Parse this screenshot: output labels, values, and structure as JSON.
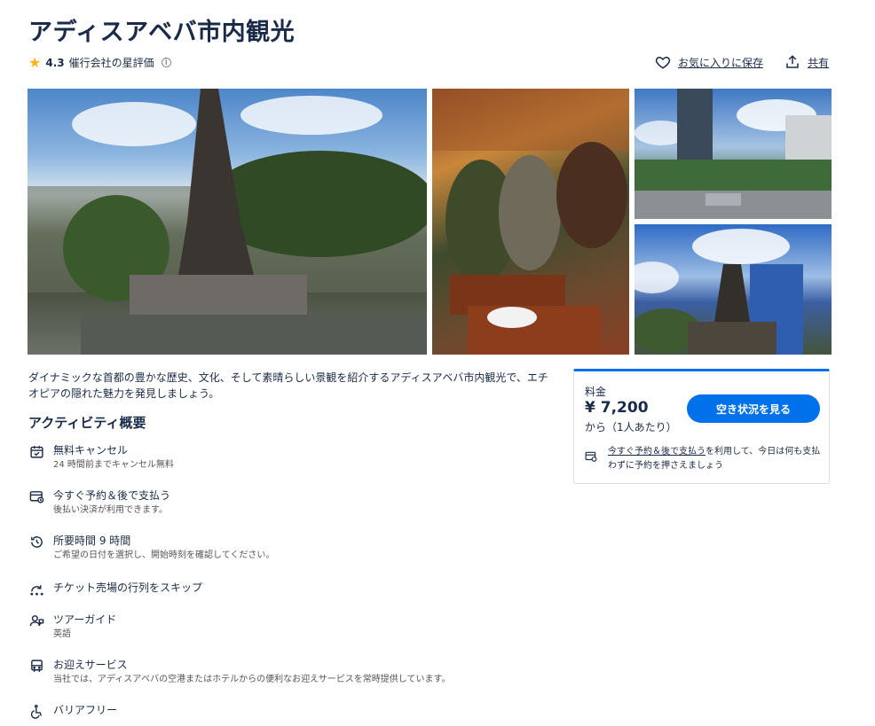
{
  "header": {
    "title": "アディスアベバ市内観光",
    "rating": "4.3",
    "rating_label": "催行会社の星評価",
    "favorite_label": "お気に入りに保存",
    "share_label": "共有"
  },
  "description": "ダイナミックな首都の豊かな歴史、文化、そして素晴らしい景観を紹介するアディスアベバ市内観光で、エチオピアの隠れた魅力を発見しましょう。",
  "overview": {
    "title": "アクティビティ概要",
    "items": [
      {
        "icon": "calendar-check-icon",
        "title": "無料キャンセル",
        "sub": "24 時間前までキャンセル無料"
      },
      {
        "icon": "reserve-pay-later-icon",
        "title": "今すぐ予約＆後で支払う",
        "sub": "後払い決済が利用できます。"
      },
      {
        "icon": "clock-icon",
        "title": "所要時間 9 時間",
        "sub": "ご希望の日付を選択し、開始時刻を確認してください。"
      },
      {
        "icon": "skip-line-icon",
        "title": "チケット売場の行列をスキップ",
        "sub": ""
      },
      {
        "icon": "tour-guide-icon",
        "title": "ツアーガイド",
        "sub": "英語"
      },
      {
        "icon": "bus-icon",
        "title": "お迎えサービス",
        "sub": "当社では、アディスアベバの空港またはホテルからの便利なお迎えサービスを常時提供しています。"
      },
      {
        "icon": "wheelchair-icon",
        "title": "バリアフリー",
        "sub": ""
      }
    ]
  },
  "booking": {
    "price_label": "料金",
    "price": "¥ 7,200",
    "per_person": "から（1人あたり）",
    "button_label": "空き状況を見る",
    "note_link": "今すぐ予約＆後で支払う",
    "note_text": "を利用して、今日は何も支払わずに予約を押さえましょう"
  }
}
